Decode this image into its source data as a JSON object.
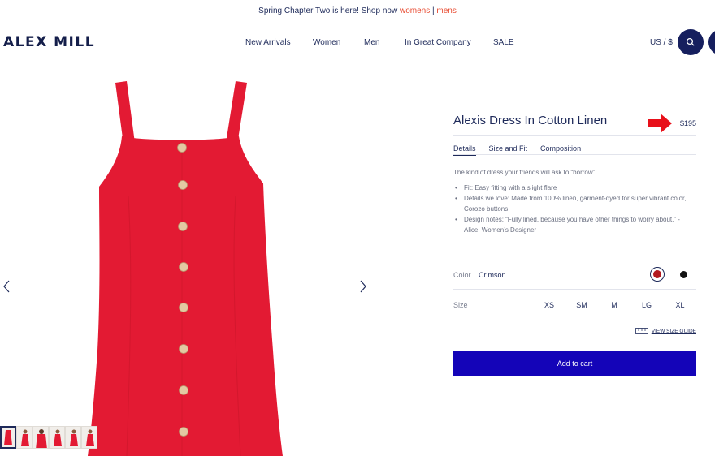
{
  "promo": {
    "text": "Spring Chapter Two is here! Shop now ",
    "link_womens": "womens",
    "separator": " | ",
    "link_mens": "mens"
  },
  "header": {
    "logo": "ALEX MILL",
    "nav": [
      "New Arrivals",
      "Women",
      "Men",
      "In Great Company",
      "SALE"
    ],
    "currency": "US / $",
    "icons": [
      "search-icon",
      "account-icon"
    ]
  },
  "product": {
    "title": "Alexis Dress In Cotton Linen",
    "price": "$195",
    "tabs": [
      "Details",
      "Size and Fit",
      "Composition"
    ],
    "active_tab": "Details",
    "description": "The kind of dress your friends will ask to “borrow”.",
    "bullets": [
      "Fit: Easy fitting with a slight flare",
      "Details we love: Made from 100% linen, garment-dyed for super vibrant color, Corozo buttons",
      "Design notes: “Fully lined, because you have other things to worry about.” - Alice, Women’s Designer"
    ],
    "color_label": "Color",
    "color_value": "Crimson",
    "swatches": [
      {
        "name": "Crimson",
        "hex": "#b3191f",
        "selected": true
      },
      {
        "name": "Black",
        "hex": "#141414",
        "selected": false
      }
    ],
    "size_label": "Size",
    "sizes": [
      "XS",
      "SM",
      "M",
      "LG",
      "XL"
    ],
    "size_guide": "VIEW SIZE GUIDE",
    "add_to_cart": "Add to cart"
  },
  "colors": {
    "brand_navy": "#1e2a5a",
    "accent_orange": "#e8492f",
    "cart_blue": "#1404b8",
    "dress_red": "#e31a33",
    "annotation_arrow": "#e8101a"
  }
}
